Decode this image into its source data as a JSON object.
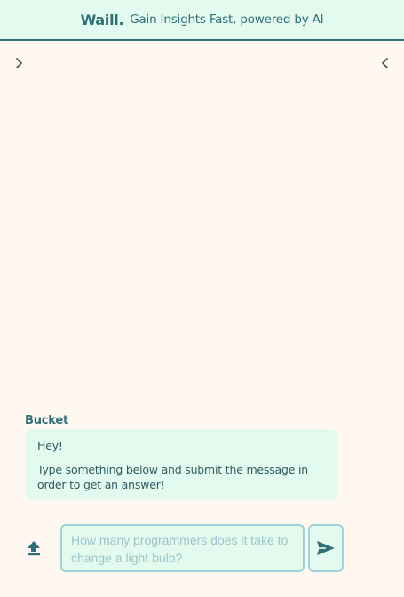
{
  "header": {
    "brand": "Waill.",
    "tagline": "Gain Insights Fast, powered by AI"
  },
  "sidebar_toggles": {
    "left_icon": "chevron-right-icon",
    "right_icon": "chevron-left-icon"
  },
  "chat": {
    "messages": [
      {
        "sender": "Bucket",
        "lines": [
          "Hey!",
          "Type something below and submit the message in order to get an answer!"
        ]
      }
    ]
  },
  "composer": {
    "placeholder": "How many programmers does it take to change a light bulb?",
    "value": "",
    "upload_icon": "upload-icon",
    "send_icon": "send-icon"
  },
  "colors": {
    "background": "#fff8f1",
    "header_bg": "#e3fbef",
    "accent": "#2e6f78",
    "bubble_bg": "#e3fbef",
    "input_border": "#9fd3dc"
  }
}
